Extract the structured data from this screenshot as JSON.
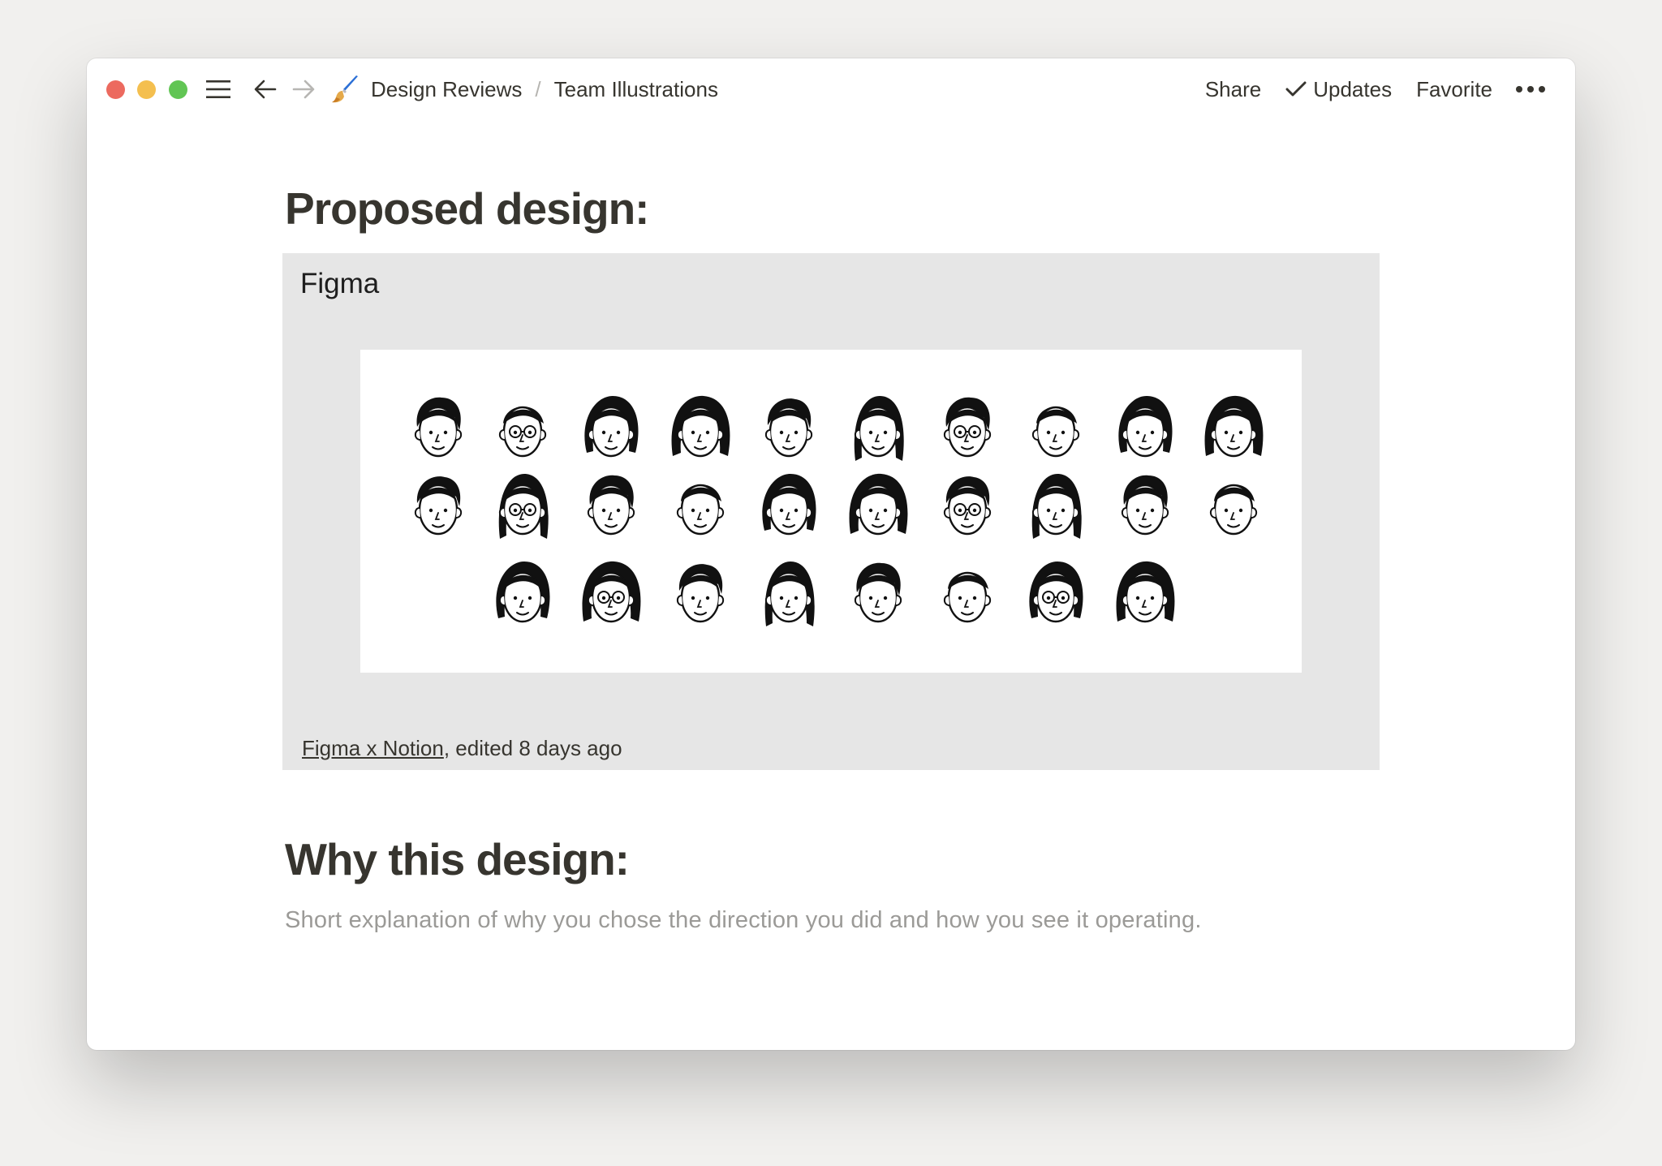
{
  "window": {
    "breadcrumb": [
      "Design Reviews",
      "Team Illustrations"
    ],
    "breadcrumb_separator": "/",
    "page_icon": "paintbrush-icon",
    "actions": {
      "share": "Share",
      "updates": "Updates",
      "favorite": "Favorite"
    }
  },
  "page": {
    "heading_1": "Proposed design:",
    "embed": {
      "provider": "Figma",
      "file_link": "Figma x Notion",
      "edited": ", edited 8 days ago",
      "preview_description": "Grid of 28 black-and-white hand-drawn team portrait illustrations"
    },
    "heading_2": "Why this design:",
    "description": "Short explanation of why you chose the direction you did and how you see it operating."
  },
  "colors": {
    "traffic_red": "#ec6a5f",
    "traffic_yellow": "#f4bf4f",
    "traffic_green": "#61c554",
    "text": "#37352f",
    "muted_text": "#9b9a97",
    "embed_bg": "#e6e6e6"
  }
}
